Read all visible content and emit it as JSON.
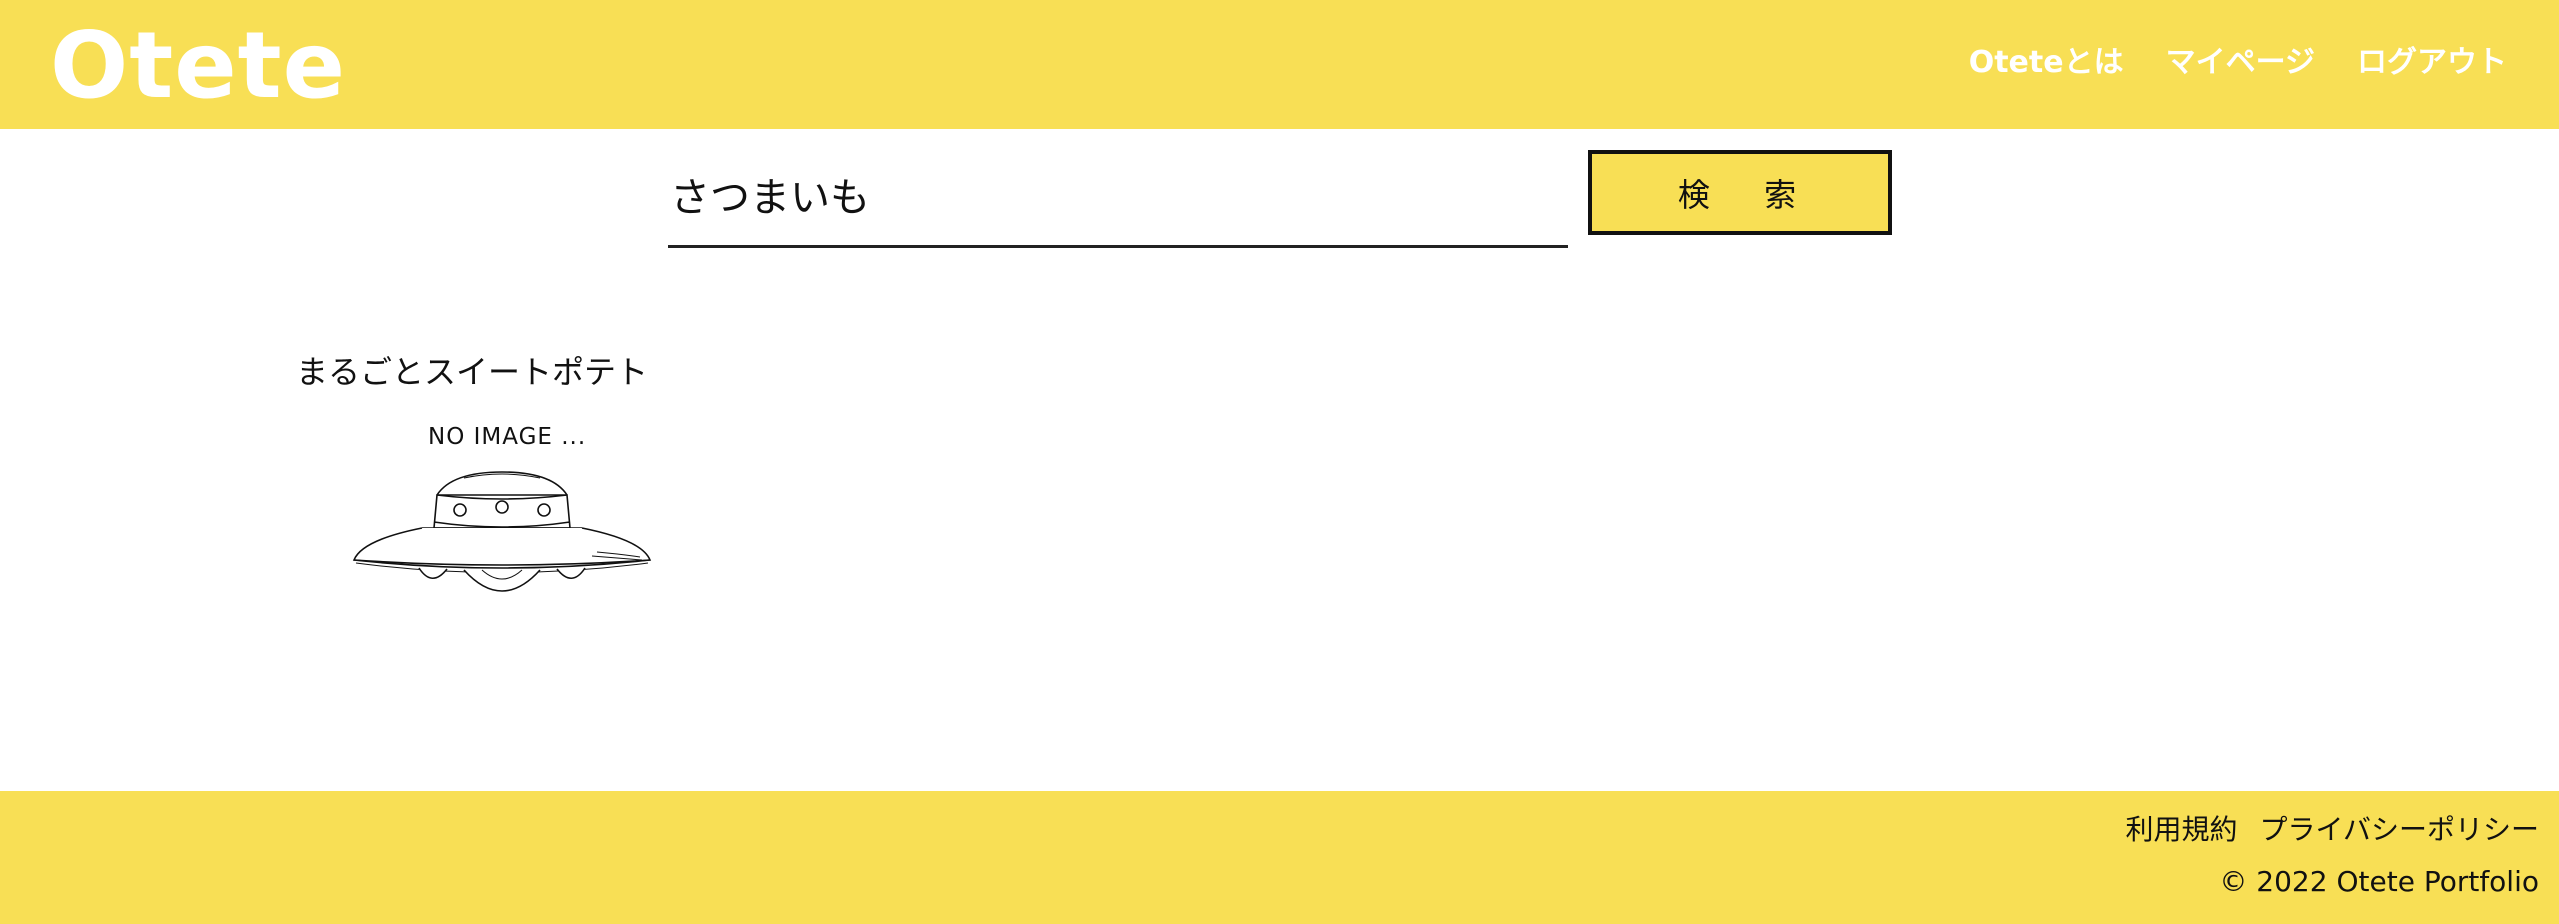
{
  "header": {
    "logo": "Otete",
    "nav": [
      {
        "label": "Oteteとは"
      },
      {
        "label": "マイページ"
      },
      {
        "label": "ログアウト"
      }
    ]
  },
  "search": {
    "value": "さつまいも",
    "button_label": "検 索"
  },
  "results": [
    {
      "title": "まるごとスイートポテト",
      "image_label": "NO IMAGE ...",
      "image_icon": "ufo-icon"
    }
  ],
  "footer": {
    "links": [
      {
        "label": "利用規約"
      },
      {
        "label": "プライバシーポリシー"
      }
    ],
    "copyright": "© 2022 Otete Portfolio"
  },
  "colors": {
    "brand_yellow": "#f8df55",
    "header_text": "#ffffff",
    "body_text": "#111111"
  }
}
